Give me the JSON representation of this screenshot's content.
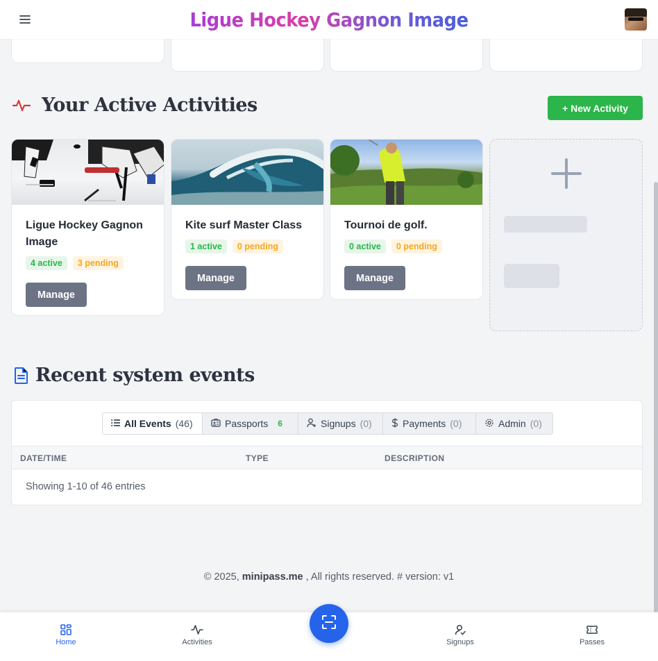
{
  "header": {
    "brand_title": "Ligue Hockey Gagnon Image",
    "menu_icon": "hamburger-icon",
    "avatar": "user-avatar"
  },
  "activities_section": {
    "title": "Your Active Activities",
    "icon": "activity-pulse-icon",
    "new_button_label": "+ New Activity",
    "cards": [
      {
        "title": "Ligue Hockey Gagnon Image",
        "active": "4 active",
        "pending": "3 pending",
        "manage_label": "Manage",
        "image": "hockey-players-image"
      },
      {
        "title": "Kite surf Master Class",
        "active": "1 active",
        "pending": "0 pending",
        "manage_label": "Manage",
        "image": "ocean-wave-image"
      },
      {
        "title": "Tournoi de golf.",
        "active": "0 active",
        "pending": "0 pending",
        "manage_label": "Manage",
        "image": "golfer-image"
      }
    ],
    "add_placeholder_icon": "plus-icon"
  },
  "events_section": {
    "title": "Recent system events",
    "icon": "document-icon",
    "filters": [
      {
        "label": "All Events",
        "count": "(46)",
        "icon": "list-icon"
      },
      {
        "label": "Passports",
        "count": "6",
        "icon": "id-card-icon"
      },
      {
        "label": "Signups",
        "count": "(0)",
        "icon": "user-plus-icon"
      },
      {
        "label": "Payments",
        "count": "(0)",
        "icon": "dollar-icon"
      },
      {
        "label": "Admin",
        "count": "(0)",
        "icon": "gear-icon"
      }
    ],
    "columns": [
      "DATE/TIME",
      "TYPE",
      "DESCRIPTION"
    ],
    "showing_text": "Showing 1-10 of 46 entries"
  },
  "footer": {
    "prefix": "© 2025,",
    "site": "minipass.me",
    "suffix": ", All rights reserved. # version: v1"
  },
  "bottom_nav": {
    "items": [
      {
        "label": "Home",
        "icon": "home-grid-icon"
      },
      {
        "label": "Activities",
        "icon": "activity-pulse-icon"
      },
      {
        "label": "Signups",
        "icon": "user-check-icon"
      },
      {
        "label": "Passes",
        "icon": "ticket-icon"
      }
    ],
    "scan_icon": "scan-icon"
  },
  "colors": {
    "accent_blue": "#2563eb",
    "success_green": "#2cb54a",
    "pending_orange": "#f5a623",
    "manage_gray": "#6b7385",
    "pulse_red": "#d33a3a"
  }
}
